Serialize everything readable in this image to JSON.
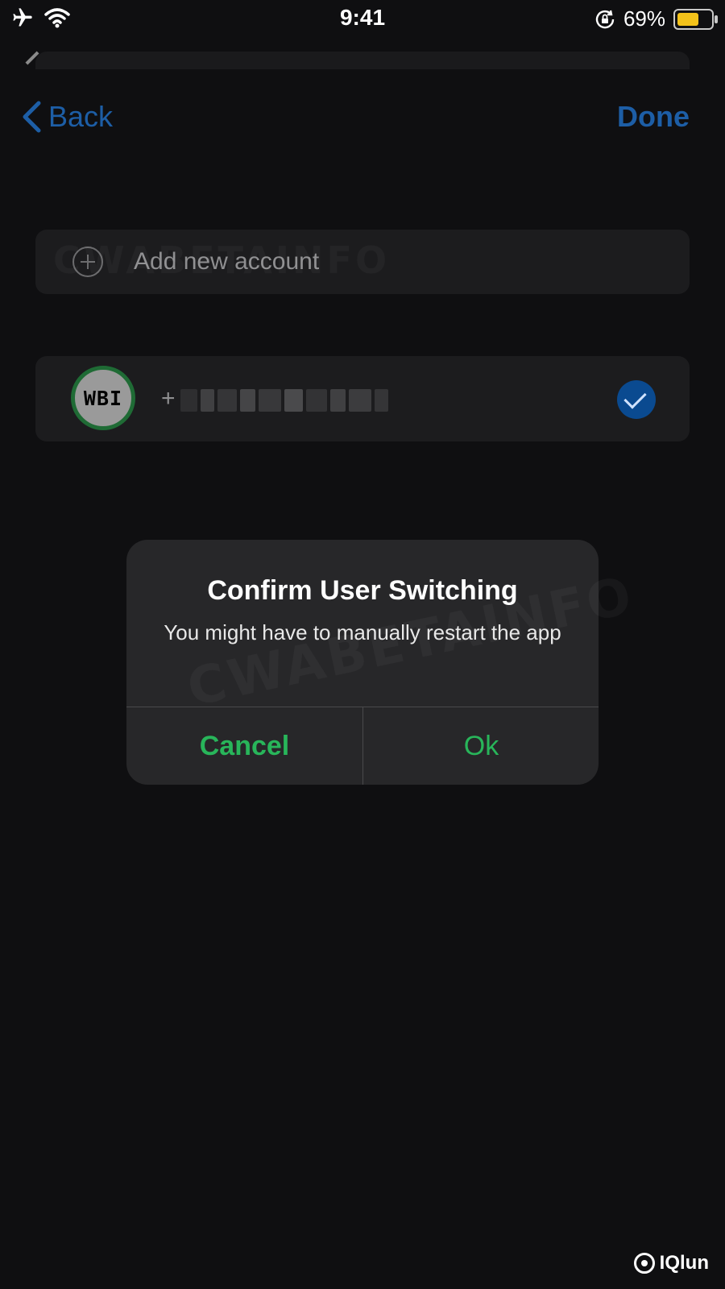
{
  "status_bar": {
    "time": "9:41",
    "battery_percent_text": "69%",
    "battery_level": 0.69,
    "icons": [
      "airplane-icon",
      "wifi-icon",
      "orientation-lock-icon",
      "battery-icon"
    ]
  },
  "nav": {
    "back_label": "Back",
    "done_label": "Done"
  },
  "accounts": {
    "add_label": "Add new account",
    "current": {
      "avatar_text": "WBI",
      "phone_prefix": "+"
    }
  },
  "alert": {
    "title": "Confirm User Switching",
    "message": "You might have to manually restart the app",
    "cancel_label": "Cancel",
    "ok_label": "Ok"
  },
  "watermark": {
    "text": "CWABETAINFO"
  },
  "brand": {
    "name": "IQlun"
  },
  "colors": {
    "link": "#1d5ea6",
    "alert_button": "#28b55a",
    "check": "#0a4a90",
    "avatar_ring": "#1f6b35",
    "battery_fill": "#f3c21a"
  }
}
